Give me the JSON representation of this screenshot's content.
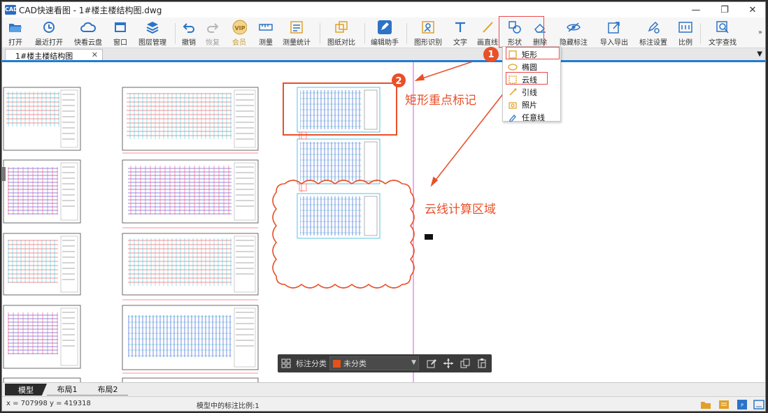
{
  "window": {
    "title": "CAD快速看图 - 1#楼主楼结构图.dwg",
    "logo_text": "CAD",
    "minimize": "—",
    "restore": "❐",
    "close": "✕"
  },
  "toolbar": {
    "items": [
      {
        "label": "打开",
        "icon": "folder-open-icon"
      },
      {
        "label": "最近打开",
        "icon": "recent-icon"
      },
      {
        "label": "快看云盘",
        "icon": "cloud-icon"
      },
      {
        "label": "窗口",
        "icon": "window-icon"
      },
      {
        "label": "图层管理",
        "icon": "layers-icon"
      },
      {
        "label": "撤销",
        "icon": "undo-icon"
      },
      {
        "label": "恢复",
        "icon": "redo-icon"
      },
      {
        "label": "会员",
        "icon": "vip-icon",
        "badge": "VIP"
      },
      {
        "label": "测量",
        "icon": "measure-icon"
      },
      {
        "label": "测量统计",
        "icon": "measure-stats-icon"
      },
      {
        "label": "图纸对比",
        "icon": "compare-icon"
      },
      {
        "label": "编辑助手",
        "icon": "edit-assistant-icon"
      },
      {
        "label": "图形识别",
        "icon": "shape-recognize-icon"
      },
      {
        "label": "文字",
        "icon": "text-icon"
      },
      {
        "label": "画直线",
        "icon": "line-icon"
      },
      {
        "label": "形状",
        "icon": "shape-icon"
      },
      {
        "label": "删除",
        "icon": "eraser-icon"
      },
      {
        "label": "隐藏标注",
        "icon": "hide-markup-icon"
      },
      {
        "label": "导入导出",
        "icon": "import-export-icon"
      },
      {
        "label": "标注设置",
        "icon": "markup-settings-icon"
      },
      {
        "label": "比例",
        "icon": "scale-icon"
      },
      {
        "label": "文字查找",
        "icon": "text-search-icon"
      }
    ],
    "more": "»"
  },
  "tabs": {
    "active": "1#楼主楼结构图",
    "close": "✕",
    "list_arrow": "▼"
  },
  "shape_menu": {
    "items": [
      {
        "label": "矩形",
        "icon": "rectangle-icon"
      },
      {
        "label": "椭圆",
        "icon": "ellipse-icon"
      },
      {
        "label": "云线",
        "icon": "cloud-line-icon"
      },
      {
        "label": "引线",
        "icon": "leader-icon"
      },
      {
        "label": "照片",
        "icon": "photo-icon"
      },
      {
        "label": "任意线",
        "icon": "freehand-icon"
      }
    ]
  },
  "annotations": {
    "marker1": "1",
    "marker2": "2",
    "rect_note": "矩形重点标记",
    "cloud_note": "云线计算区域",
    "accent": "#e8502a",
    "highlight_box": "#e8474c"
  },
  "markup_bar": {
    "category_label": "标注分类",
    "category_value": "未分类",
    "swatch_color": "#e2521a"
  },
  "layout_tabs": [
    "模型",
    "布局1",
    "布局2"
  ],
  "status": {
    "coords": "x = 707998  y = 419318",
    "scale_text": "模型中的标注比例:1"
  }
}
